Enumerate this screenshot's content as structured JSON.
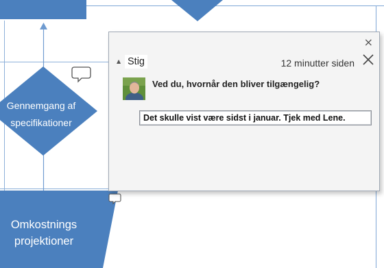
{
  "diagram": {
    "shapes": {
      "specification_review": [
        "Gennemgang af",
        "specifikationer"
      ],
      "cost_projections": [
        "Omkostnings",
        "projektioner"
      ]
    }
  },
  "comment_panel": {
    "close_label": "×",
    "thread": {
      "author": "Stig",
      "timestamp": "12 minutter siden",
      "comment_text": "Ved du, hvornår den bliver tilgængelig?",
      "reply_value": "Det skulle vist være sidst i januar. Tjek med Lene."
    }
  },
  "colors": {
    "shape_fill": "#4b80be",
    "connector": "#7fa7d6",
    "panel_background": "#f4f4f4",
    "panel_border": "#9fa8b4"
  }
}
